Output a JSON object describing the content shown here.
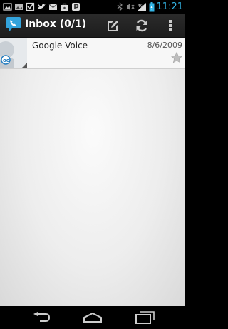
{
  "status_bar": {
    "time": "11:21",
    "notification_icons": [
      "image-icon",
      "gallery-icon",
      "checkbox-icon",
      "bird-icon",
      "gmail-icon",
      "bag-icon",
      "p-icon"
    ],
    "system_icons": [
      "bluetooth-icon",
      "mute-icon",
      "signal-icon",
      "battery-icon"
    ]
  },
  "action_bar": {
    "title": "Inbox (0/1)",
    "actions": [
      "compose-icon",
      "refresh-icon",
      "overflow-menu-icon"
    ]
  },
  "messages": [
    {
      "sender": "Google Voice",
      "date": "8/6/2009",
      "starred": false
    }
  ],
  "nav_bar": [
    "back-icon",
    "home-icon",
    "recents-icon"
  ],
  "colors": {
    "clock": "#33b5e5",
    "action_bar": "#262626",
    "app_icon": "#33a3dc"
  }
}
